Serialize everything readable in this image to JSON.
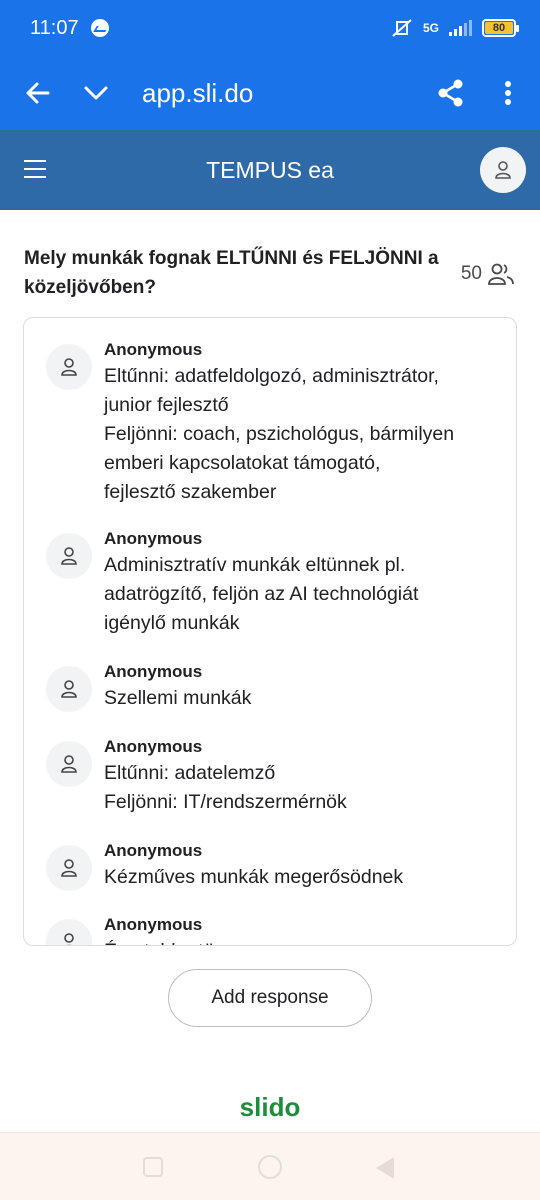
{
  "status_bar": {
    "time": "11:07",
    "network": "5G",
    "battery": "80"
  },
  "browser": {
    "url": "app.sli.do"
  },
  "app_header": {
    "title": "TEMPUS ea"
  },
  "question": {
    "title": "Mely munkák fognak ELTŰNNI és FELJÖNNI a közeljövőben?",
    "participant_count": "50"
  },
  "responses": [
    {
      "author": "Anonymous",
      "text": "Eltűnni: adatfeldolgozó, adminisztrátor,\njunior fejlesztő\nFeljönni: coach, pszichológus, bármilyen\nemberi kapcsolatokat támogató,\nfejlesztő szakember"
    },
    {
      "author": "Anonymous",
      "text": "Adminisztratív munkák eltünnek pl.\nadatrögzítő, feljön az AI technológiát\nigénylő munkák"
    },
    {
      "author": "Anonymous",
      "text": "Szellemi munkák"
    },
    {
      "author": "Anonymous",
      "text": "Eltűnni: adatelemző\nFeljönni: IT/rendszermérnök"
    },
    {
      "author": "Anonymous",
      "text": "Kézműves munkák megerősödnek"
    },
    {
      "author": "Anonymous",
      "text": "Ércetebb...tömeg..."
    }
  ],
  "actions": {
    "add_response_label": "Add response"
  },
  "footer": {
    "brand": "slido"
  }
}
